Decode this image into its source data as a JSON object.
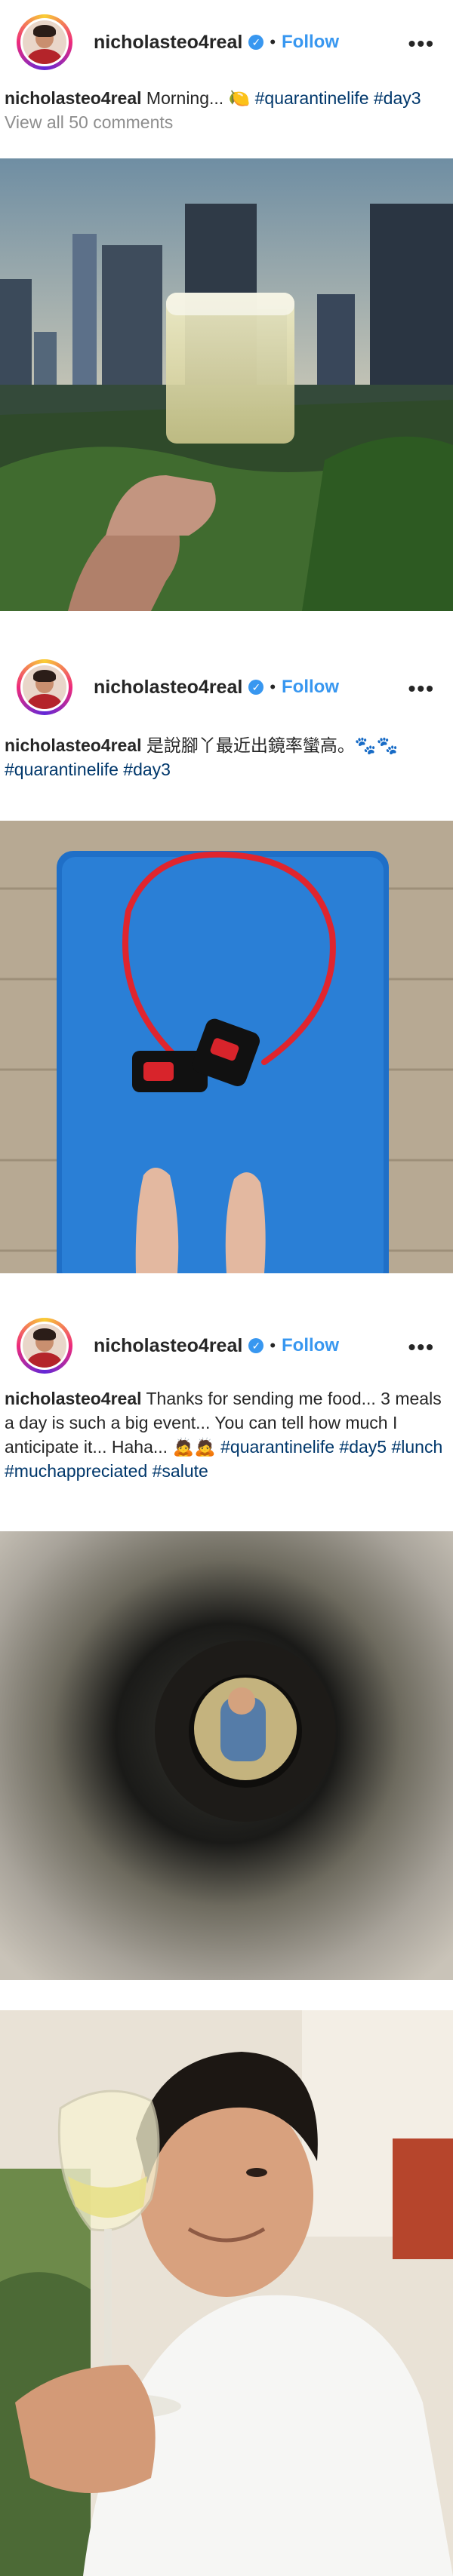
{
  "posts": [
    {
      "username": "nicholasteo4real",
      "follow_label": "Follow",
      "more_label": "•••",
      "caption_user": "nicholasteo4real",
      "caption_text": " Morning... ",
      "caption_emoji": "🍋",
      "caption_tags": "#quarantinelife #day3",
      "caption_second_line": "View all 50 comments"
    },
    {
      "username": "nicholasteo4real",
      "follow_label": "Follow",
      "more_label": "•••",
      "caption_user": "nicholasteo4real",
      "caption_text": " 是說腳丫最近出鏡率蠻高。",
      "caption_emoji": "🐾🐾",
      "caption_tags": "#quarantinelife #day3"
    },
    {
      "username": "nicholasteo4real",
      "follow_label": "Follow",
      "more_label": "•••",
      "caption_user": "nicholasteo4real",
      "caption_text": " Thanks for sending me food... 3 meals a day is such a big event... You can tell how much I anticipate it... Haha... ",
      "caption_emoji": "🙇🙇",
      "caption_tags": "#quarantinelife #day5 #lunch #muchappreciated #salute"
    }
  ]
}
